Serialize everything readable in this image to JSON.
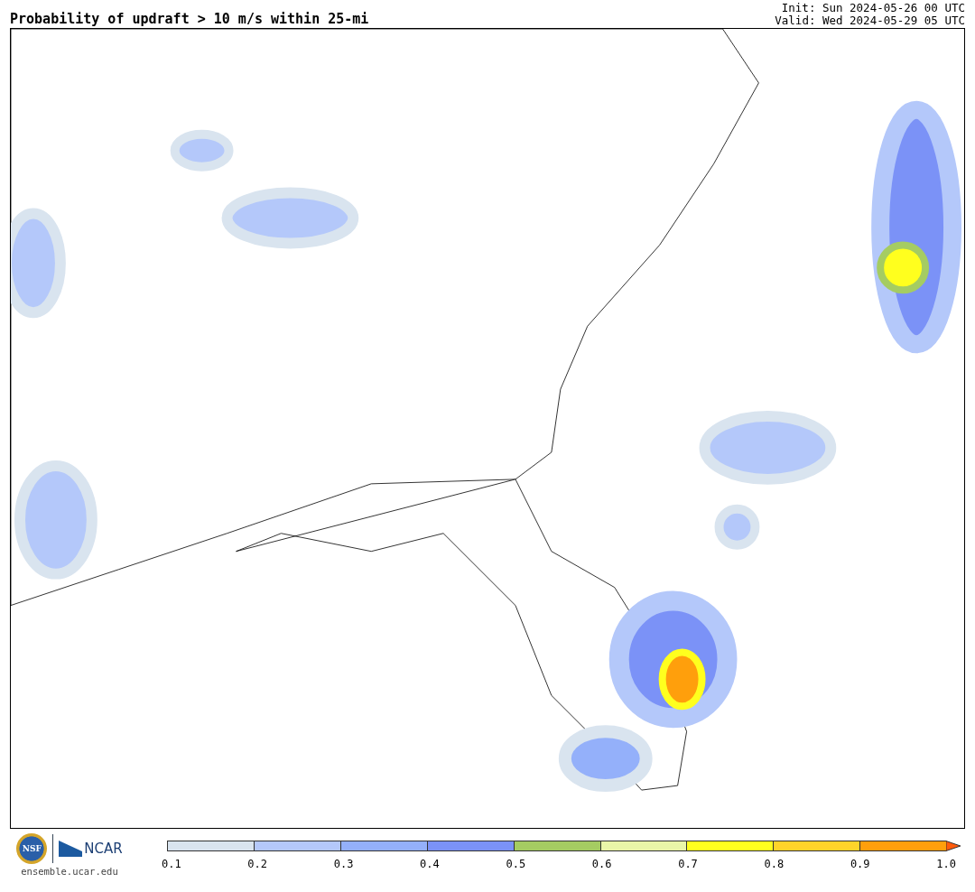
{
  "header": {
    "title": "Probability of updraft > 10 m/s within 25-mi",
    "init": "Init: Sun 2024-05-26 00 UTC",
    "valid": "Valid: Wed 2024-05-29 05 UTC"
  },
  "footer": {
    "logo_text": "NSF",
    "brand": "NCAR",
    "url": "ensemble.ucar.edu"
  },
  "legend": {
    "segments": [
      {
        "color": "#d9e4ef"
      },
      {
        "color": "#b4c8fa"
      },
      {
        "color": "#94b0fa"
      },
      {
        "color": "#7b92f7"
      },
      {
        "color": "#a5cc62"
      },
      {
        "color": "#e9f6a8"
      },
      {
        "color": "#ffff1e"
      },
      {
        "color": "#ffd42a"
      },
      {
        "color": "#ff9f0c"
      },
      {
        "color": "#ff5a0c",
        "kind": "arrow"
      }
    ],
    "ticks": [
      "0.1",
      "0.2",
      "0.3",
      "0.4",
      "0.5",
      "0.6",
      "0.7",
      "0.8",
      "0.9",
      "1.0"
    ]
  }
}
